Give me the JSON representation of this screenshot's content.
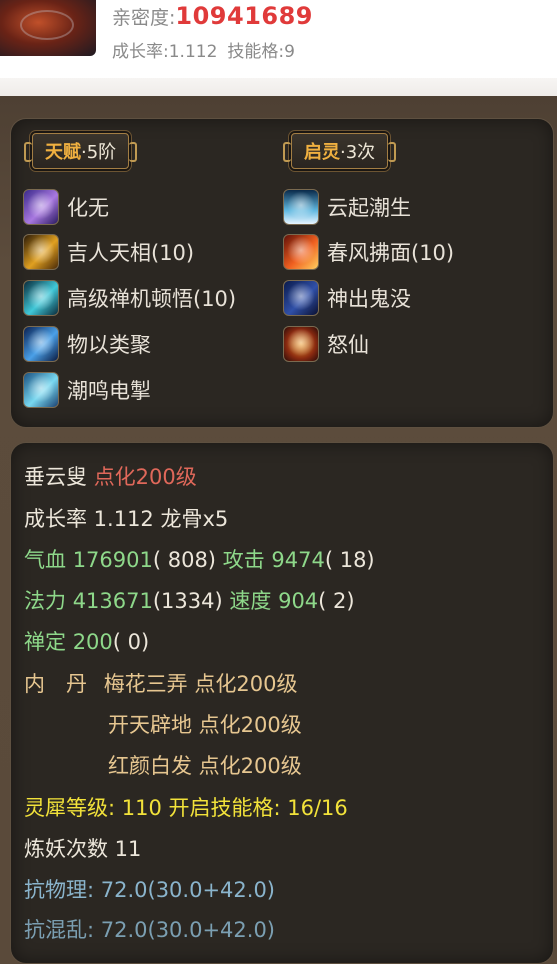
{
  "header": {
    "intimacy_label": "亲密度:",
    "intimacy_value": "10941689",
    "growth_rate": "成长率:1.112",
    "skill_slots": "技能格:9"
  },
  "talent": {
    "label": "天赋",
    "value": "·5阶",
    "skills": [
      {
        "name": "化无",
        "icon": "swirl-purple-icon"
      },
      {
        "name": "吉人天相(10)",
        "icon": "golden-figure-icon"
      },
      {
        "name": "高级禅机顿悟(10)",
        "icon": "zen-rune-icon"
      },
      {
        "name": "物以类聚",
        "icon": "blue-orb-icon"
      },
      {
        "name": "潮鸣电掣",
        "icon": "wave-lightning-icon"
      }
    ]
  },
  "spirit": {
    "label": "启灵",
    "value": "·3次",
    "skills": [
      {
        "name": "云起潮生",
        "icon": "cloud-tide-icon"
      },
      {
        "name": "春风拂面(10)",
        "icon": "fire-wind-icon"
      },
      {
        "name": "神出鬼没",
        "icon": "hidden-rune-icon"
      },
      {
        "name": "怒仙",
        "icon": "fury-immortal-icon"
      }
    ]
  },
  "stats": {
    "name": "垂云叟",
    "enlighten": "点化200级",
    "growth": "成长率 1.112 龙骨x5",
    "hp_label": "气血",
    "hp_value": "176901",
    "hp_extra": "( 808)",
    "atk_label": "攻击",
    "atk_value": "9474",
    "atk_extra": "( 18)",
    "mp_label": "法力",
    "mp_value": "413671",
    "mp_extra": "(1334)",
    "spd_label": "速度",
    "spd_value": "904",
    "spd_extra": "( 2)",
    "zen_label": "禅定",
    "zen_value": "200",
    "zen_extra": "( 0)",
    "dan_label": "内　丹",
    "dan1": "梅花三弄 点化200级",
    "dan2": "开天辟地 点化200级",
    "dan3": "红颜白发 点化200级",
    "rhino": "灵犀等级: 110 开启技能格: 16/16",
    "refine": "炼妖次数 11",
    "resist_phys": "抗物理: 72.0(30.0+42.0)",
    "resist_chaos": "抗混乱: 72.0(30.0+42.0)"
  }
}
